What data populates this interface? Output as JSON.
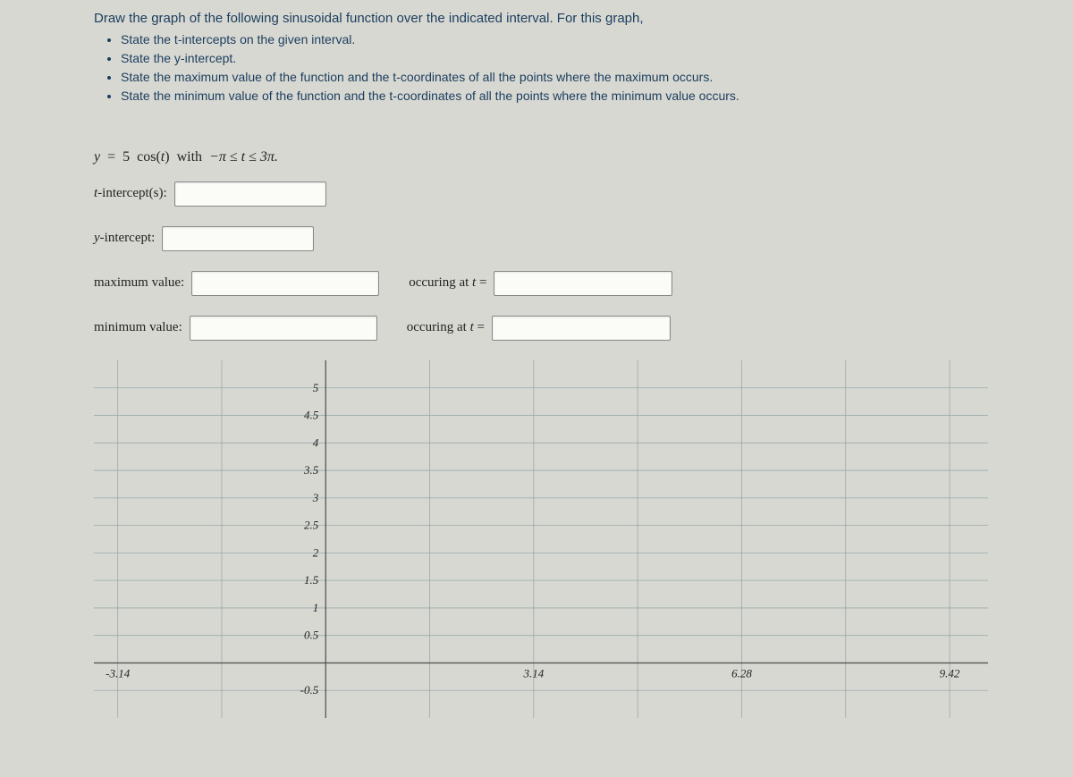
{
  "problem": {
    "intro": "Draw the graph of the following sinusoidal function over the indicated interval. For this graph,",
    "bullets": [
      "State the t-intercepts on the given interval.",
      "State the y-intercept.",
      "State the maximum value of the function and the t-coordinates of all the points where the maximum occurs.",
      "State the minimum value of the function and the t-coordinates of all the points where the minimum value occurs."
    ]
  },
  "formula": {
    "lhs": "y",
    "eq": "=",
    "coeff": "5",
    "fn": "cos",
    "arg": "t",
    "with": "with",
    "range": "−π ≤ t ≤ 3π."
  },
  "fields": {
    "t_intercepts_label": "t-intercept(s):",
    "t_intercepts_value": "",
    "y_intercept_label": "y-intercept:",
    "y_intercept_value": "",
    "max_label": "maximum value:",
    "max_value": "",
    "max_at_label": "occuring at t =",
    "max_at_value": "",
    "min_label": "minimum value:",
    "min_value": "",
    "min_at_label": "occuring at t =",
    "min_at_value": ""
  },
  "chart_data": {
    "type": "line",
    "title": "",
    "xlabel": "",
    "ylabel": "",
    "xlim": [
      -3.5,
      10
    ],
    "ylim": [
      -1,
      5.5
    ],
    "x_ticks": [
      -3.14,
      3.14,
      6.28,
      9.42
    ],
    "y_ticks": [
      -0.5,
      0.5,
      1,
      1.5,
      2,
      2.5,
      3,
      3.5,
      4,
      4.5,
      5
    ],
    "y_tick_labels": [
      "-0.5",
      "0.5",
      "1",
      "1.5",
      "2",
      "2.5",
      "3",
      "3.5",
      "4",
      "4.5",
      "5"
    ],
    "x_gridlines": [
      -3.14,
      -1.57,
      1.57,
      3.14,
      4.71,
      6.28,
      7.85,
      9.42
    ],
    "series": []
  }
}
